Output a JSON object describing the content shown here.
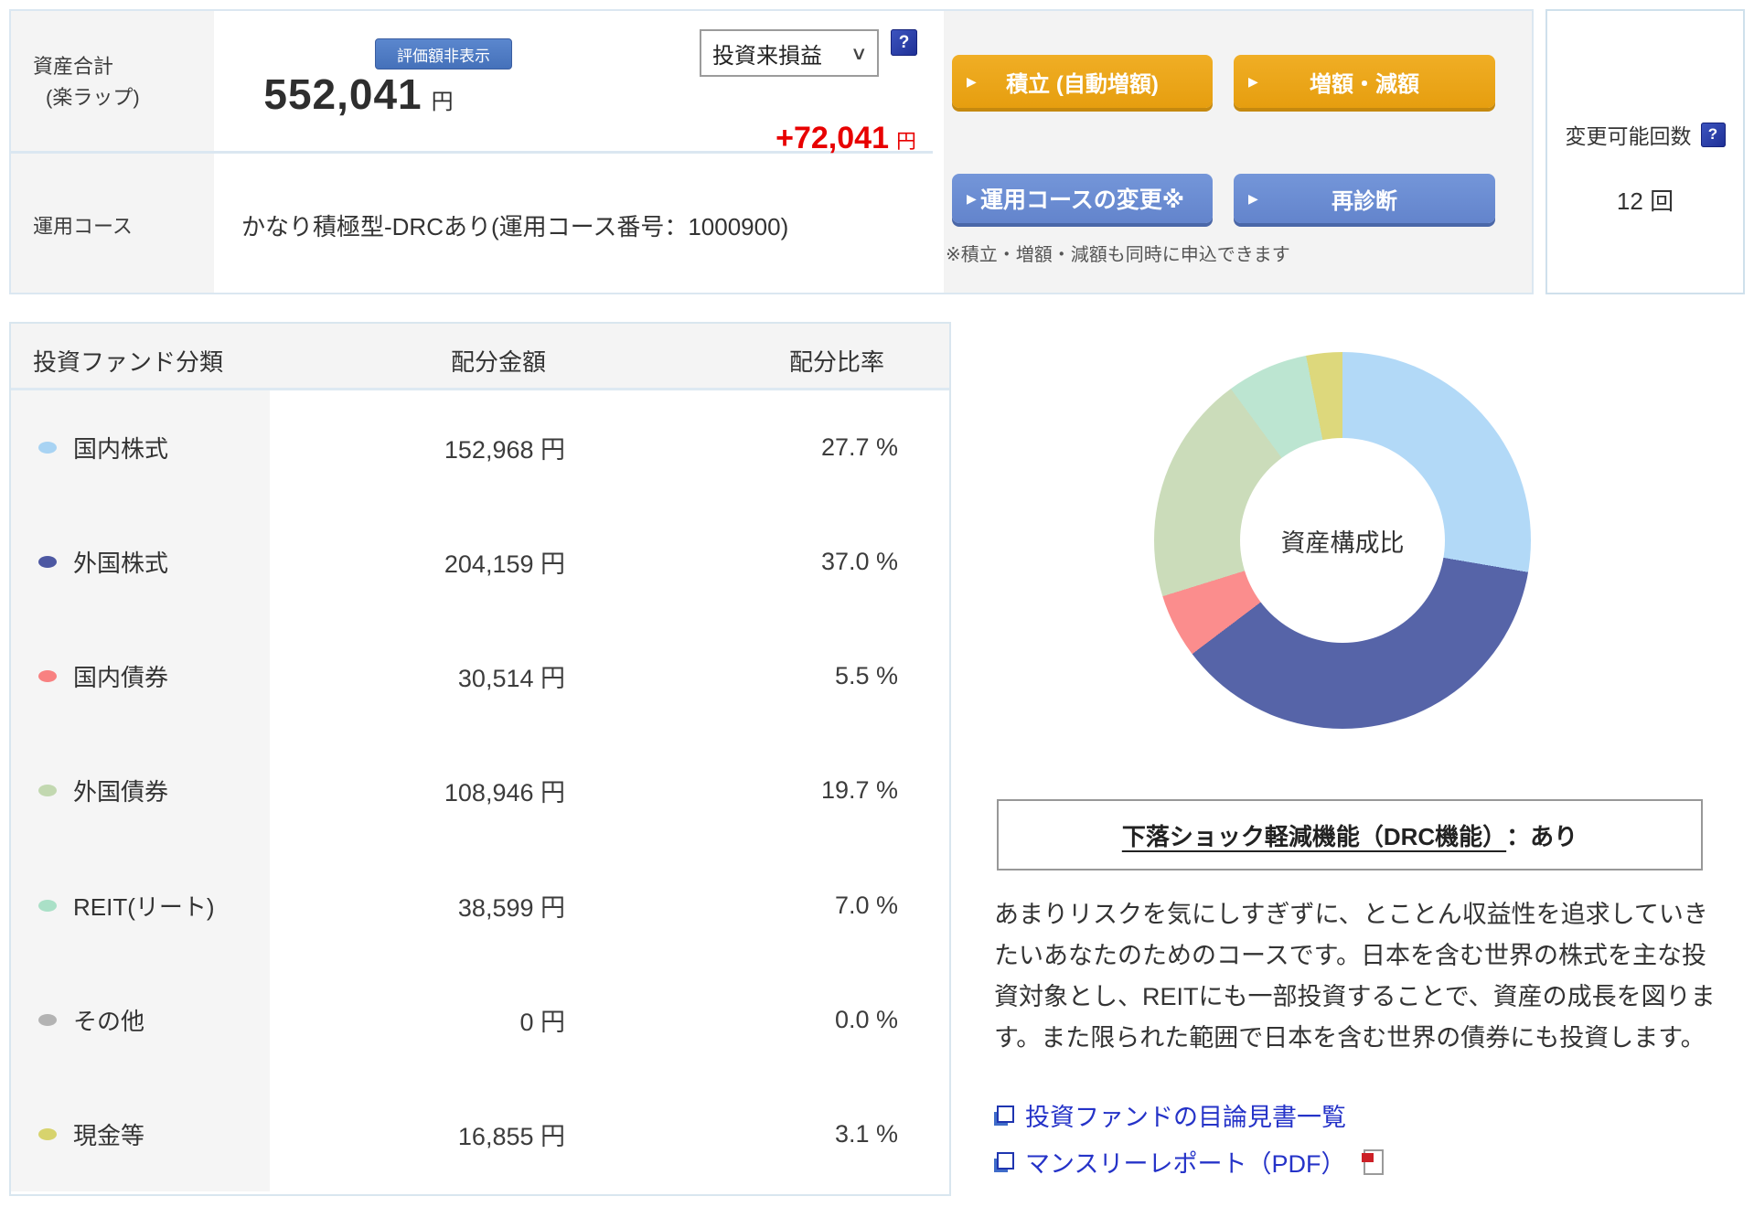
{
  "summary": {
    "asset_total_label_line1": "資産合計",
    "asset_total_label_line2": "(楽ラップ)",
    "hide_value_button": "評価額非表示",
    "total_value": "552,041",
    "total_unit": "円",
    "profit_dropdown_value": "投資来損益",
    "profit_value": "+72,041",
    "profit_unit": "円",
    "help_icon_glyph": "?",
    "buttons": {
      "tsumitate": "積立 (自動増額)",
      "zougaku": "増額・減額",
      "course_change": "運用コースの変更※",
      "rediagnosis": "再診断",
      "note": "※積立・増額・減額も同時に申込できます"
    },
    "course_label": "運用コース",
    "course_value": "かなり積極型-DRCあり(運用コース番号：1000900)",
    "change_count_label": "変更可能回数",
    "change_count_value": "12 回"
  },
  "allocation_table": {
    "headers": [
      "投資ファンド分類",
      "配分金額",
      "配分比率"
    ],
    "rows": [
      {
        "label": "国内株式",
        "color": "#a8d3f3",
        "amount": "152,968 円",
        "ratio": "27.7 %"
      },
      {
        "label": "外国株式",
        "color": "#4d58a2",
        "amount": "204,159 円",
        "ratio": "37.0 %"
      },
      {
        "label": "国内債券",
        "color": "#f88181",
        "amount": "30,514 円",
        "ratio": "5.5 %"
      },
      {
        "label": "外国債券",
        "color": "#c2d8b0",
        "amount": "108,946 円",
        "ratio": "19.7 %"
      },
      {
        "label": "REIT(リート)",
        "color": "#aae0c7",
        "amount": "38,599 円",
        "ratio": "7.0 %"
      },
      {
        "label": "その他",
        "color": "#b3b3b3",
        "amount": "0 円",
        "ratio": "0.0 %"
      },
      {
        "label": "現金等",
        "color": "#d7d36d",
        "amount": "16,855 円",
        "ratio": "3.1 %"
      }
    ]
  },
  "chart_data": {
    "type": "pie",
    "donut": true,
    "title": "資産構成比",
    "categories": [
      "国内株式",
      "外国株式",
      "国内債券",
      "外国債券",
      "REIT(リート)",
      "その他",
      "現金等"
    ],
    "values": [
      27.7,
      37.0,
      5.5,
      19.7,
      7.0,
      0.0,
      3.1
    ],
    "colors": [
      "#b2d9f7",
      "#5664a8",
      "#fb8d8d",
      "#cbdcba",
      "#bce5d1",
      "#b3b3b3",
      "#ddd87c"
    ],
    "start_angle_deg": 0,
    "direction": "clockwise",
    "inner_radius_ratio": 0.54,
    "legend_position": "none"
  },
  "drc": {
    "box_title_underlined": "下落ショック軽減機能（DRC機能）",
    "box_title_suffix": "：あり",
    "description": "あまりリスクを気にしすぎずに、とことん収益性を追求していきたいあなたのためのコースです。日本を含む世界の株式を主な投資対象とし、REITにも一部投資することで、資産の成長を図ります。また限られた範囲で日本を含む世界の債券にも投資します。",
    "links": [
      {
        "label": "投資ファンドの目論見書一覧"
      },
      {
        "label": "マンスリーレポート（PDF）"
      }
    ]
  }
}
